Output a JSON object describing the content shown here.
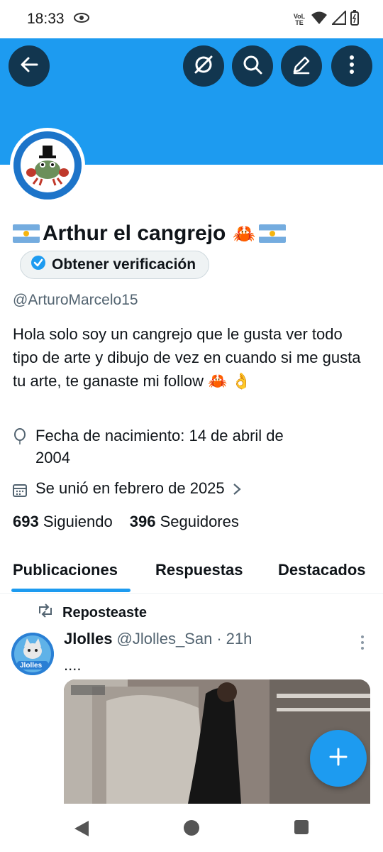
{
  "status_bar": {
    "time": "18:33",
    "network": "VoLTE"
  },
  "header": {
    "back_label": "Back",
    "icons": [
      "arrow-left-icon",
      "no-grok-icon",
      "search-icon",
      "edit-icon",
      "more-vertical-icon"
    ]
  },
  "colors": {
    "accent": "#1d9bf0",
    "text": "#0f1419",
    "muted": "#536471"
  },
  "profile": {
    "display_name": "Arthur el cangrejo",
    "name_emoji": "🦀",
    "verify_label": "Obtener verificación",
    "handle": "@ArturoMarcelo15",
    "bio": "Hola solo soy un cangrejo que le gusta ver todo tipo de arte y dibujo de vez en cuando si me gusta tu arte, te ganaste mi follow 🦀 👌",
    "birthdate_line1": "Fecha de nacimiento: 14 de abril de",
    "birthdate_line2": "2004",
    "joined": "Se unió en febrero de 2025",
    "following_count": "693",
    "following_label": "Siguiendo",
    "followers_count": "396",
    "followers_label": "Seguidores"
  },
  "tabs": [
    {
      "label": "Publicaciones",
      "selected": true
    },
    {
      "label": "Respuestas",
      "selected": false
    },
    {
      "label": "Destacados",
      "selected": false
    }
  ],
  "post": {
    "repost_label": "Reposteaste",
    "author_name": "Jlolles",
    "author_handle": "@Jlolles_San",
    "separator": "·",
    "time": "21h",
    "text": "....",
    "avatar_text": "Jlolles"
  }
}
